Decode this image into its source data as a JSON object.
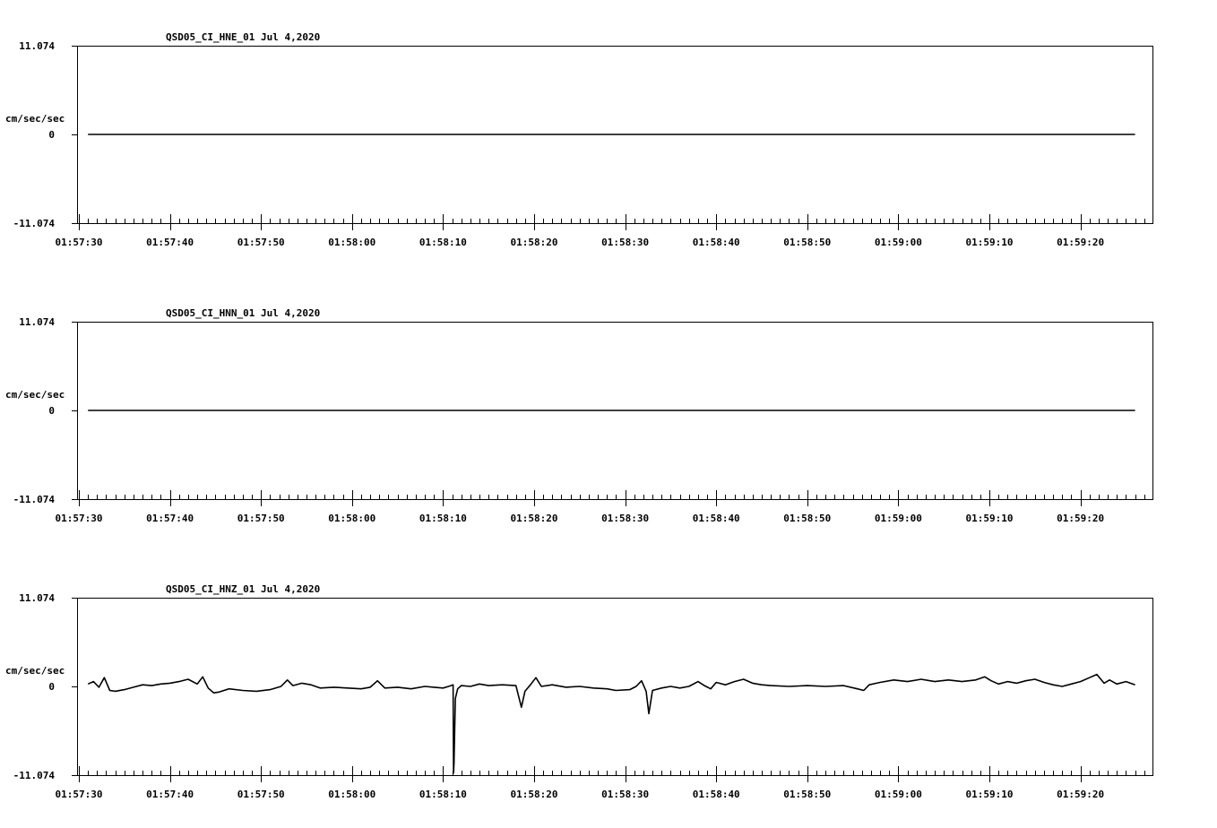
{
  "chart_data": [
    {
      "type": "line",
      "title": "QSD05_CI_HNE_01  Jul 4,2020",
      "ylabel": "cm/sec/sec",
      "y_tick_labels": [
        "11.074",
        "0",
        "-11.074"
      ],
      "ylim": [
        -11.074,
        11.074
      ],
      "x_tick_labels": [
        "01:57:30",
        "01:57:40",
        "01:57:50",
        "01:58:00",
        "01:58:10",
        "01:58:20",
        "01:58:30",
        "01:58:40",
        "01:58:50",
        "01:59:00",
        "01:59:10",
        "01:59:20"
      ],
      "x_range_seconds": [
        0,
        117
      ],
      "series": [
        {
          "points": [
            [
              1,
              0
            ],
            [
              116,
              0
            ]
          ]
        }
      ]
    },
    {
      "type": "line",
      "title": "QSD05_CI_HNN_01  Jul 4,2020",
      "ylabel": "cm/sec/sec",
      "y_tick_labels": [
        "11.074",
        "0",
        "-11.074"
      ],
      "ylim": [
        -11.074,
        11.074
      ],
      "x_tick_labels": [
        "01:57:30",
        "01:57:40",
        "01:57:50",
        "01:58:00",
        "01:58:10",
        "01:58:20",
        "01:58:30",
        "01:58:40",
        "01:58:50",
        "01:59:00",
        "01:59:10",
        "01:59:20"
      ],
      "x_range_seconds": [
        0,
        117
      ],
      "series": [
        {
          "points": [
            [
              1,
              0
            ],
            [
              116,
              0
            ]
          ]
        }
      ]
    },
    {
      "type": "line",
      "title": "QSD05_CI_HNZ_01  Jul 4,2020",
      "ylabel": "cm/sec/sec",
      "y_tick_labels": [
        "11.074",
        "0",
        "-11.074"
      ],
      "ylim": [
        -11.074,
        11.074
      ],
      "x_tick_labels": [
        "01:57:30",
        "01:57:40",
        "01:57:50",
        "01:58:00",
        "01:58:10",
        "01:58:20",
        "01:58:30",
        "01:58:40",
        "01:58:50",
        "01:59:00",
        "01:59:10",
        "01:59:20"
      ],
      "x_range_seconds": [
        0,
        117
      ],
      "series": [
        {
          "points": [
            [
              1,
              0.3
            ],
            [
              1.6,
              0.6
            ],
            [
              2.2,
              -0.1
            ],
            [
              2.8,
              1.1
            ],
            [
              3.4,
              -0.5
            ],
            [
              4,
              -0.6
            ],
            [
              5,
              -0.4
            ],
            [
              6,
              -0.1
            ],
            [
              7,
              0.2
            ],
            [
              8,
              0.1
            ],
            [
              9,
              0.3
            ],
            [
              10,
              0.4
            ],
            [
              11,
              0.6
            ],
            [
              12,
              0.9
            ],
            [
              13,
              0.3
            ],
            [
              13.6,
              1.2
            ],
            [
              14.2,
              -0.2
            ],
            [
              14.8,
              -0.8
            ],
            [
              15.4,
              -0.7
            ],
            [
              16.5,
              -0.3
            ],
            [
              18,
              -0.5
            ],
            [
              19.5,
              -0.6
            ],
            [
              21,
              -0.4
            ],
            [
              22.2,
              0
            ],
            [
              22.9,
              0.8
            ],
            [
              23.5,
              0.1
            ],
            [
              24.5,
              0.4
            ],
            [
              25.5,
              0.2
            ],
            [
              26.5,
              -0.2
            ],
            [
              28,
              -0.1
            ],
            [
              29.5,
              -0.2
            ],
            [
              31,
              -0.3
            ],
            [
              32,
              -0.1
            ],
            [
              32.8,
              0.7
            ],
            [
              33.6,
              -0.2
            ],
            [
              35,
              -0.1
            ],
            [
              36.5,
              -0.3
            ],
            [
              38,
              0
            ],
            [
              39,
              -0.1
            ],
            [
              40,
              -0.2
            ],
            [
              40.6,
              0
            ],
            [
              41.1,
              0.2
            ],
            [
              41.15,
              -10.8
            ],
            [
              41.2,
              -9.6
            ],
            [
              41.35,
              -1.5
            ],
            [
              41.6,
              -0.3
            ],
            [
              42,
              0.1
            ],
            [
              43,
              0
            ],
            [
              44,
              0.3
            ],
            [
              45,
              0.1
            ],
            [
              46.5,
              0.2
            ],
            [
              48,
              0.1
            ],
            [
              48.6,
              -2.6
            ],
            [
              49,
              -0.6
            ],
            [
              49.6,
              0.2
            ],
            [
              50.2,
              1.1
            ],
            [
              50.8,
              0
            ],
            [
              52,
              0.2
            ],
            [
              53.5,
              -0.1
            ],
            [
              55,
              0
            ],
            [
              56.5,
              -0.2
            ],
            [
              58,
              -0.3
            ],
            [
              59,
              -0.5
            ],
            [
              60.5,
              -0.4
            ],
            [
              61.2,
              0
            ],
            [
              61.8,
              0.7
            ],
            [
              62.3,
              -0.6
            ],
            [
              62.6,
              -3.4
            ],
            [
              63,
              -0.5
            ],
            [
              64,
              -0.2
            ],
            [
              65,
              0
            ],
            [
              66,
              -0.2
            ],
            [
              67,
              0
            ],
            [
              68,
              0.6
            ],
            [
              68.7,
              0.1
            ],
            [
              69.4,
              -0.3
            ],
            [
              70,
              0.5
            ],
            [
              71,
              0.2
            ],
            [
              72,
              0.6
            ],
            [
              73,
              0.9
            ],
            [
              74,
              0.4
            ],
            [
              75,
              0.2
            ],
            [
              76,
              0.1
            ],
            [
              78,
              0
            ],
            [
              80,
              0.1
            ],
            [
              82,
              0
            ],
            [
              84,
              0.1
            ],
            [
              85.5,
              -0.3
            ],
            [
              86.2,
              -0.5
            ],
            [
              86.8,
              0.2
            ],
            [
              88,
              0.5
            ],
            [
              89.5,
              0.8
            ],
            [
              91,
              0.6
            ],
            [
              92.5,
              0.9
            ],
            [
              94,
              0.6
            ],
            [
              95.5,
              0.8
            ],
            [
              97,
              0.6
            ],
            [
              98.5,
              0.8
            ],
            [
              99.5,
              1.2
            ],
            [
              100.2,
              0.7
            ],
            [
              101,
              0.3
            ],
            [
              102,
              0.6
            ],
            [
              103,
              0.4
            ],
            [
              104,
              0.7
            ],
            [
              105,
              0.9
            ],
            [
              106,
              0.5
            ],
            [
              107,
              0.2
            ],
            [
              108,
              0
            ],
            [
              109,
              0.3
            ],
            [
              110,
              0.6
            ],
            [
              111,
              1.1
            ],
            [
              111.8,
              1.5
            ],
            [
              112.6,
              0.4
            ],
            [
              113.2,
              0.8
            ],
            [
              114,
              0.3
            ],
            [
              115,
              0.6
            ],
            [
              116,
              0.2
            ]
          ]
        }
      ]
    }
  ]
}
